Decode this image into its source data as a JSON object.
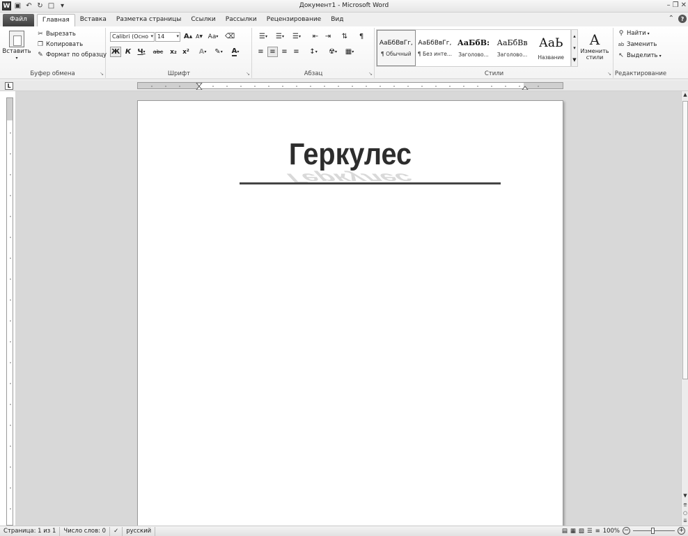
{
  "window": {
    "title": "Документ1 - Microsoft Word",
    "quick_access": [
      "word-icon",
      "save-icon",
      "undo-icon",
      "redo-icon",
      "new-doc-icon",
      "customize-icon"
    ]
  },
  "tabs": [
    {
      "label": "Файл",
      "kind": "file"
    },
    {
      "label": "Главная",
      "kind": "active"
    },
    {
      "label": "Вставка"
    },
    {
      "label": "Разметка страницы"
    },
    {
      "label": "Ссылки"
    },
    {
      "label": "Рассылки"
    },
    {
      "label": "Рецензирование"
    },
    {
      "label": "Вид"
    }
  ],
  "clipboard": {
    "paste_label": "Вставить",
    "cut_label": "Вырезать",
    "copy_label": "Копировать",
    "format_painter_label": "Формат по образцу",
    "group_label": "Буфер обмена"
  },
  "font": {
    "family": "Calibri (Осно",
    "size": "14",
    "grow": "A",
    "shrink": "A",
    "case": "Aa",
    "bold": "Ж",
    "italic": "К",
    "underline": "Ч",
    "strike": "abc",
    "subscript": "x₂",
    "superscript": "x²",
    "group_label": "Шрифт"
  },
  "paragraph": {
    "group_label": "Абзац"
  },
  "styles": {
    "items": [
      {
        "preview": "АаБбВвГг,",
        "name": "¶ Обычный",
        "selected": true
      },
      {
        "preview": "АаБбВвГг,",
        "name": "¶ Без инте..."
      },
      {
        "preview": "АаБбВ:",
        "name": "Заголово..."
      },
      {
        "preview": "АаБбВв",
        "name": "Заголово..."
      },
      {
        "preview": "АаЬ",
        "name": "Название"
      }
    ],
    "change_styles_label": "Изменить стили",
    "group_label": "Стили"
  },
  "editing": {
    "find_label": "Найти",
    "replace_label": "Заменить",
    "select_label": "Выделить",
    "group_label": "Редактирование"
  },
  "document": {
    "wordart_text": "Геркулес"
  },
  "statusbar": {
    "page": "Страница: 1 из 1",
    "words": "Число слов: 0",
    "language": "русский",
    "zoom": "100%"
  }
}
